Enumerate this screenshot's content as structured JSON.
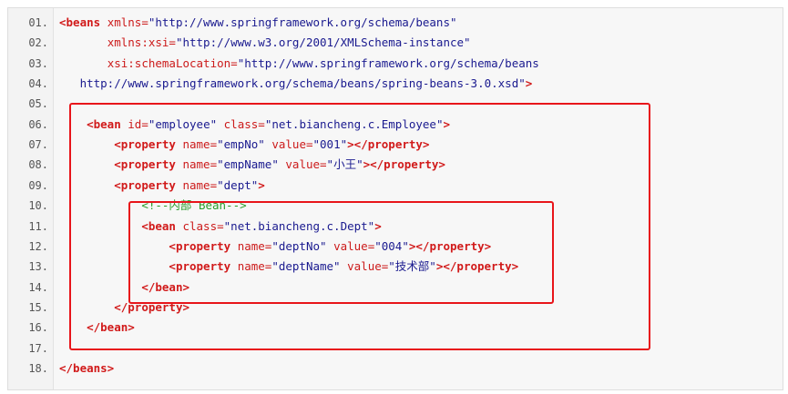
{
  "code": {
    "lines": [
      {
        "n": "01.",
        "indent": "",
        "parts": [
          [
            "tag",
            "<beans"
          ],
          [
            "plain",
            " "
          ],
          [
            "attr",
            "xmlns="
          ],
          [
            "val",
            "\"http://www.springframework.org/schema/beans\""
          ]
        ]
      },
      {
        "n": "02.",
        "indent": "       ",
        "parts": [
          [
            "attr",
            "xmlns:xsi="
          ],
          [
            "val",
            "\"http://www.w3.org/2001/XMLSchema-instance\""
          ]
        ]
      },
      {
        "n": "03.",
        "indent": "       ",
        "parts": [
          [
            "attr",
            "xsi:schemaLocation="
          ],
          [
            "val",
            "\"http://www.springframework.org/schema/beans"
          ]
        ]
      },
      {
        "n": "04.",
        "indent": "   ",
        "parts": [
          [
            "val",
            "http://www.springframework.org/schema/beans/spring-beans-3.0.xsd\""
          ],
          [
            "tag",
            ">"
          ]
        ]
      },
      {
        "n": "05.",
        "indent": "",
        "parts": []
      },
      {
        "n": "06.",
        "indent": "    ",
        "parts": [
          [
            "tag",
            "<bean"
          ],
          [
            "plain",
            " "
          ],
          [
            "attr",
            "id="
          ],
          [
            "val",
            "\"employee\""
          ],
          [
            "plain",
            " "
          ],
          [
            "attr",
            "class="
          ],
          [
            "val",
            "\"net.biancheng.c.Employee\""
          ],
          [
            "tag",
            ">"
          ]
        ]
      },
      {
        "n": "07.",
        "indent": "        ",
        "parts": [
          [
            "tag",
            "<property"
          ],
          [
            "plain",
            " "
          ],
          [
            "attr",
            "name="
          ],
          [
            "val",
            "\"empNo\""
          ],
          [
            "plain",
            " "
          ],
          [
            "attr",
            "value="
          ],
          [
            "val",
            "\"001\""
          ],
          [
            "tag",
            "></property>"
          ]
        ]
      },
      {
        "n": "08.",
        "indent": "        ",
        "parts": [
          [
            "tag",
            "<property"
          ],
          [
            "plain",
            " "
          ],
          [
            "attr",
            "name="
          ],
          [
            "val",
            "\"empName\""
          ],
          [
            "plain",
            " "
          ],
          [
            "attr",
            "value="
          ],
          [
            "val",
            "\"小王\""
          ],
          [
            "tag",
            "></property>"
          ]
        ]
      },
      {
        "n": "09.",
        "indent": "        ",
        "parts": [
          [
            "tag",
            "<property"
          ],
          [
            "plain",
            " "
          ],
          [
            "attr",
            "name="
          ],
          [
            "val",
            "\"dept\""
          ],
          [
            "tag",
            ">"
          ]
        ]
      },
      {
        "n": "10.",
        "indent": "            ",
        "parts": [
          [
            "comment",
            "<!--内部 Bean-->"
          ]
        ]
      },
      {
        "n": "11.",
        "indent": "            ",
        "parts": [
          [
            "tag",
            "<bean"
          ],
          [
            "plain",
            " "
          ],
          [
            "attr",
            "class="
          ],
          [
            "val",
            "\"net.biancheng.c.Dept\""
          ],
          [
            "tag",
            ">"
          ]
        ]
      },
      {
        "n": "12.",
        "indent": "                ",
        "parts": [
          [
            "tag",
            "<property"
          ],
          [
            "plain",
            " "
          ],
          [
            "attr",
            "name="
          ],
          [
            "val",
            "\"deptNo\""
          ],
          [
            "plain",
            " "
          ],
          [
            "attr",
            "value="
          ],
          [
            "val",
            "\"004\""
          ],
          [
            "tag",
            "></property>"
          ]
        ]
      },
      {
        "n": "13.",
        "indent": "                ",
        "parts": [
          [
            "tag",
            "<property"
          ],
          [
            "plain",
            " "
          ],
          [
            "attr",
            "name="
          ],
          [
            "val",
            "\"deptName\""
          ],
          [
            "plain",
            " "
          ],
          [
            "attr",
            "value="
          ],
          [
            "val",
            "\"技术部\""
          ],
          [
            "tag",
            "></property>"
          ]
        ]
      },
      {
        "n": "14.",
        "indent": "            ",
        "parts": [
          [
            "tag",
            "</bean>"
          ]
        ]
      },
      {
        "n": "15.",
        "indent": "        ",
        "parts": [
          [
            "tag",
            "</property>"
          ]
        ]
      },
      {
        "n": "16.",
        "indent": "    ",
        "parts": [
          [
            "tag",
            "</bean>"
          ]
        ]
      },
      {
        "n": "17.",
        "indent": "",
        "parts": []
      },
      {
        "n": "18.",
        "indent": "",
        "parts": [
          [
            "tag",
            "</beans>"
          ]
        ]
      }
    ]
  },
  "colors": {
    "tag": "#d11a1a",
    "value": "#1a1a8f",
    "comment": "#2a9d2a",
    "highlight": "#e8151a"
  }
}
